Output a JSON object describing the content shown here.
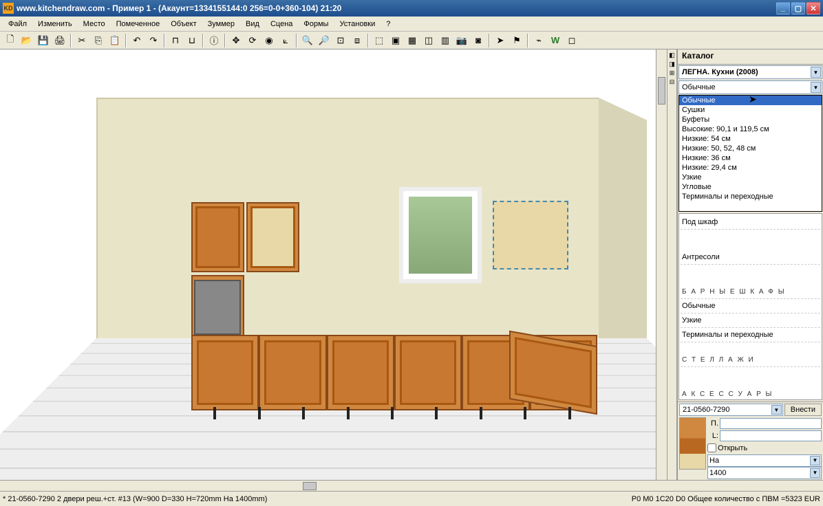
{
  "titlebar": {
    "text": "www.kitchendraw.com - Пример 1 - (Акаунт=1334155144:0 256=0-0+360-104) 21:20",
    "icon_label": "KD"
  },
  "menu": [
    "Файл",
    "Изменить",
    "Место",
    "Помеченное",
    "Объект",
    "Зуммер",
    "Вид",
    "Сцена",
    "Формы",
    "Установки",
    "?"
  ],
  "catalog": {
    "tab": "Каталог",
    "brand": "ЛЕГНА. Кухни (2008)",
    "category": "Обычные"
  },
  "dropdown": [
    "Обычные",
    "Сушки",
    "Буфеты",
    "Высокие: 90,1 и 119,5 см",
    "Низкие: 54 см",
    "Низкие: 50, 52, 48 см",
    "Низкие: 36 см",
    "Низкие: 29,4 см",
    "Узкие",
    "Угловые",
    "Терминалы и переходные"
  ],
  "categories": [
    {
      "label": "Под шкаф",
      "type": "item"
    },
    {
      "label": "Антресоли",
      "type": "item"
    },
    {
      "label": "Б А Р Н Ы Е   Ш К А Ф Ы",
      "type": "header"
    },
    {
      "label": "Обычные",
      "type": "item"
    },
    {
      "label": "Узкие",
      "type": "item"
    },
    {
      "label": "Терминалы и переходные",
      "type": "item"
    },
    {
      "label": "С Т Е Л Л А Ж И",
      "type": "header"
    },
    {
      "label": "А К С Е С С У А Р Ы",
      "type": "header"
    }
  ],
  "item": {
    "code": "21-0560-7290",
    "insert_btn": "Внести",
    "p_label": "П.",
    "l_label": "L:",
    "open_label": "Открыть",
    "na_label": "На",
    "dim_value": "1400"
  },
  "status": {
    "left": "* 21-0560-7290  2 двери реш.+ст. #13  (W=900 D=330 H=720mm На 1400mm)",
    "right": "P0 M0 1C20 D0 Общее количество с ПВМ =5323 EUR"
  },
  "toolbar_icons": [
    "new",
    "open",
    "save",
    "print",
    "cut",
    "copy",
    "paste",
    "undo",
    "redo",
    "ruler1",
    "ruler2",
    "info",
    "move",
    "zoom-reset",
    "spin",
    "axis",
    "zoom-in",
    "zoom-out",
    "zoom-fit",
    "zoom-region",
    "sel-all",
    "layer",
    "grid1",
    "grid2",
    "grid3",
    "camera",
    "snapshot",
    "arrow",
    "flag",
    "path",
    "wall",
    "blank"
  ]
}
